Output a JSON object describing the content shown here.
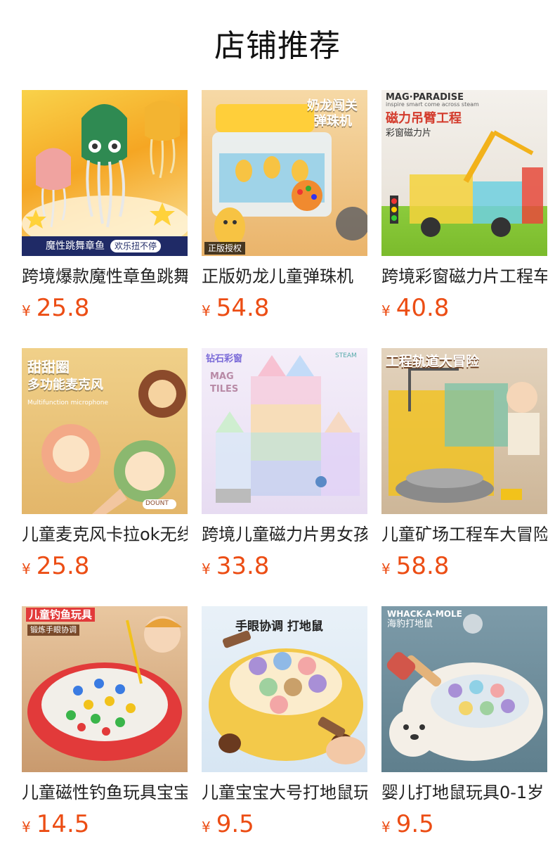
{
  "section": {
    "title": "店铺推荐"
  },
  "products": [
    {
      "name": "跨境爆款魔性章鱼跳舞",
      "currency": "¥",
      "price": "25.8",
      "image_text": {
        "bottom_bar": "魔性跳舞章鱼",
        "pill": "欢乐扭不停"
      },
      "colors": {
        "bg": "#f6b92a",
        "accent": "#2e8b57"
      }
    },
    {
      "name": "正版奶龙儿童弹珠机",
      "currency": "¥",
      "price": "54.8",
      "image_text": {
        "headline": "奶龙闯关",
        "headline2": "弹珠机",
        "badge": "正版授权"
      },
      "colors": {
        "bg": "#f3c27a",
        "accent": "#f0a53a"
      }
    },
    {
      "name": "跨境彩窗磁力片工程车",
      "currency": "¥",
      "price": "40.8",
      "image_text": {
        "brand": "MAG·PARADISE",
        "tagline": "inspire smart come across steam",
        "headline": "磁力吊臂工程",
        "sub": "彩窗磁力片"
      },
      "colors": {
        "bg": "#f2efe9",
        "accent": "#d33b2c"
      }
    },
    {
      "name": "儿童麦克风卡拉ok无线",
      "currency": "¥",
      "price": "25.8",
      "image_text": {
        "headline": "甜甜圈",
        "headline2": "多功能麦克风",
        "sub": "Multifunction microphone",
        "tag": "DOUNT"
      },
      "colors": {
        "bg": "#e9c27a",
        "accent": "#8b4a2b"
      }
    },
    {
      "name": "跨境儿童磁力片男女孩",
      "currency": "¥",
      "price": "33.8",
      "image_text": {
        "headline": "钻石彩窗",
        "sub": "MAG TILES",
        "corner": "STEAM"
      },
      "colors": {
        "bg": "#efe6f7",
        "accent": "#c9a6e8"
      }
    },
    {
      "name": "儿童矿场工程车大冒险",
      "currency": "¥",
      "price": "58.8",
      "image_text": {
        "headline": "工程轨道大冒险"
      },
      "colors": {
        "bg": "#d9c8b4",
        "accent": "#f2c21b"
      }
    },
    {
      "name": "儿童磁性钓鱼玩具宝宝",
      "currency": "¥",
      "price": "14.5",
      "image_text": {
        "headline": "儿童钓鱼玩具",
        "sub": "锻炼手眼协调"
      },
      "colors": {
        "bg": "#d9b28b",
        "accent": "#e23a3a"
      }
    },
    {
      "name": "儿童宝宝大号打地鼠玩具",
      "currency": "¥",
      "price": "9.5",
      "image_text": {
        "headline": "手眼协调 打地鼠"
      },
      "colors": {
        "bg": "#dfeaf6",
        "accent": "#f3c94a"
      }
    },
    {
      "name": "婴儿打地鼠玩具0-1岁",
      "currency": "¥",
      "price": "9.5",
      "image_text": {
        "brand": "WHACK-A-MOLE",
        "headline": "海豹打地鼠"
      },
      "colors": {
        "bg": "#6f8d9b",
        "accent": "#f4efe7"
      }
    }
  ]
}
